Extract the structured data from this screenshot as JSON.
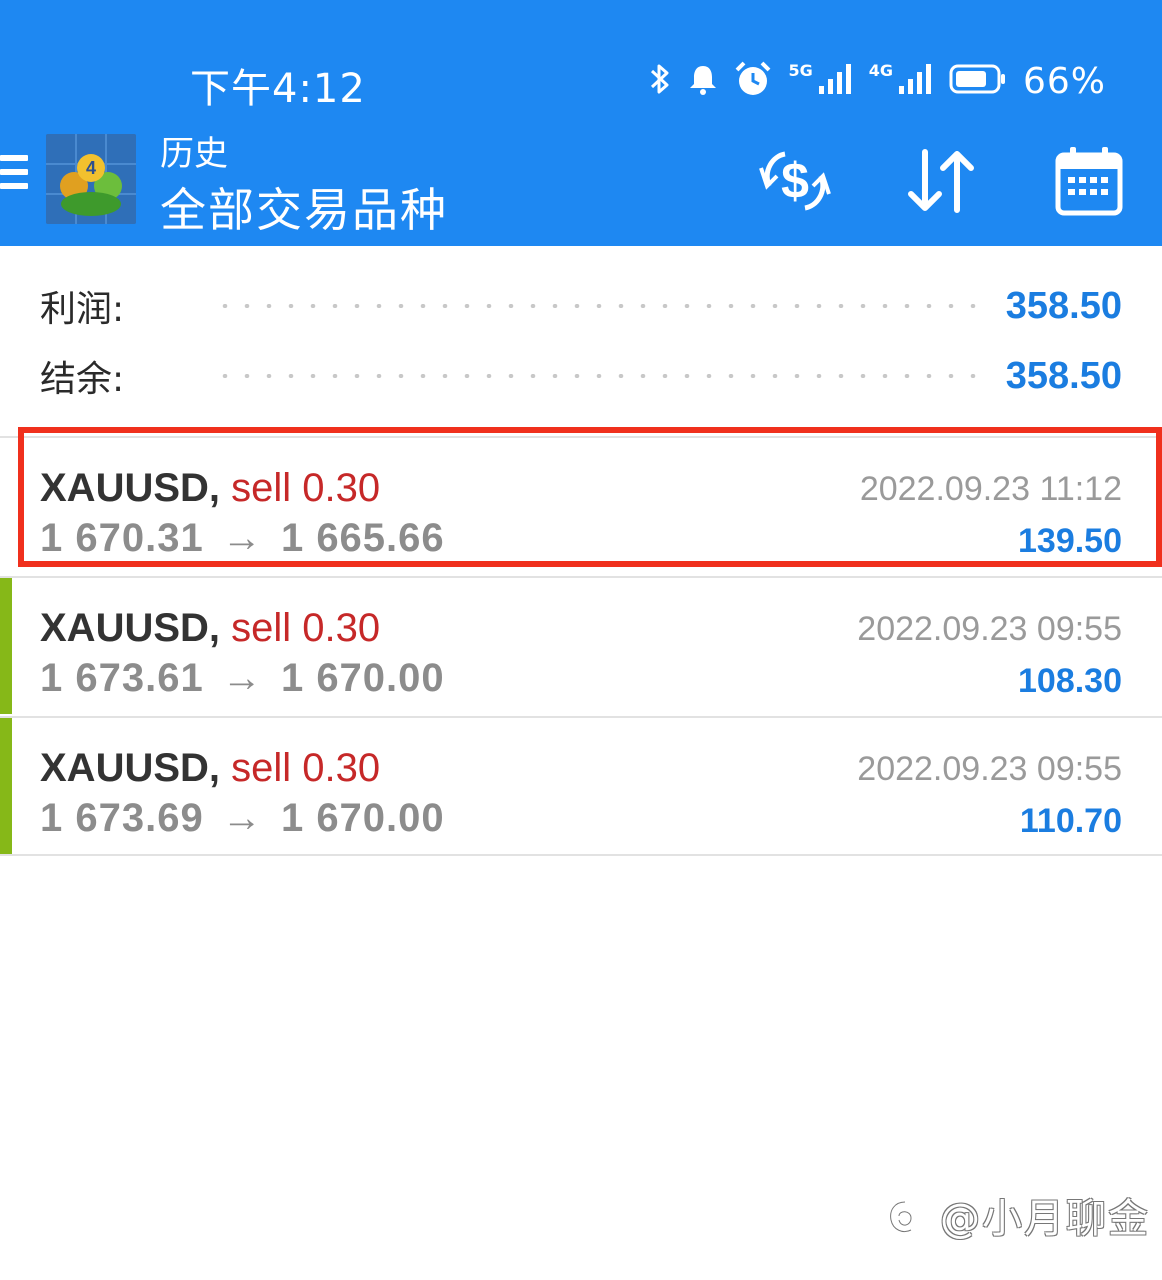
{
  "status_bar": {
    "time": "下午4:12",
    "network_1": "5G",
    "network_2": "4G",
    "battery": "66%",
    "icons": [
      "bluetooth-icon",
      "notification-bell-icon",
      "alarm-clock-icon",
      "signal-5g-icon",
      "signal-4g-icon",
      "battery-icon"
    ]
  },
  "app_bar": {
    "title": "历史",
    "subtitle": "全部交易品种",
    "icons": [
      "menu-icon",
      "metatrader-logo",
      "currency-exchange-icon",
      "sort-icon",
      "calendar-icon"
    ]
  },
  "summary": {
    "profit_label": "利润:",
    "profit_value": "358.50",
    "balance_label": "结余:",
    "balance_value": "358.50"
  },
  "trades": [
    {
      "symbol": "XAUUSD,",
      "action": "sell 0.30",
      "open_price": "1 670.31",
      "arrow": "→",
      "close_price": "1 665.66",
      "time": "2022.09.23 11:12",
      "profit": "139.50",
      "highlighted": true
    },
    {
      "symbol": "XAUUSD,",
      "action": "sell 0.30",
      "open_price": "1 673.61",
      "arrow": "→",
      "close_price": "1 670.00",
      "time": "2022.09.23 09:55",
      "profit": "108.30",
      "highlighted": false
    },
    {
      "symbol": "XAUUSD,",
      "action": "sell 0.30",
      "open_price": "1 673.69",
      "arrow": "→",
      "close_price": "1 670.00",
      "time": "2022.09.23 09:55",
      "profit": "110.70",
      "highlighted": false
    }
  ],
  "colors": {
    "header": "#1e88f2",
    "profit_blue": "#1b7de0",
    "sell_red": "#c62828",
    "indicator_green": "#86b818",
    "highlight_red": "#f0301d"
  },
  "watermark": "@小月聊金"
}
